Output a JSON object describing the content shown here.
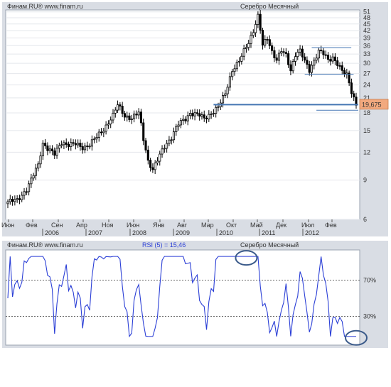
{
  "chart_data": [
    {
      "type": "candlestick",
      "header_left": "Финам.RU®  www.finam.ru",
      "header_right": "Серебро Месячный",
      "y_ticks": [
        6,
        9,
        12,
        15,
        18,
        21,
        24,
        27,
        30,
        33,
        36,
        39,
        42,
        45,
        48,
        51
      ],
      "ylim": [
        6,
        51
      ],
      "y_scale": "log",
      "month_labels": [
        "Июн",
        "Фев",
        "Сен",
        "Апр",
        "Ноя",
        "Июн",
        "Янв",
        "Авг",
        "Мар",
        "Окт",
        "Май",
        "Дек",
        "Июл",
        "Фев"
      ],
      "year_labels": [
        "2006",
        "2007",
        "2008",
        "2009",
        "2010",
        "2011",
        "2012"
      ],
      "last_value_label": "19,675",
      "up_color": "#ffffff",
      "down_color": "#000000",
      "line_color": "#4a7ab5",
      "label_box_color": "#f2a97e",
      "horizontal_lines": [
        {
          "y": 19.6,
          "from_index": 88,
          "to_index": 149,
          "style": "thick"
        },
        {
          "y": 35.3,
          "from_index": 130,
          "to_index": 146,
          "style": "thin"
        },
        {
          "y": 26.8,
          "from_index": 127,
          "to_index": 147,
          "style": "thin"
        },
        {
          "y": 18.5,
          "from_index": 132,
          "to_index": 149,
          "style": "thin"
        }
      ]
    },
    {
      "type": "line",
      "header_left": "Финам.RU®  www.finam.ru",
      "header_center": "RSI (5) = 15,46",
      "header_right": "Серебро Месячный",
      "y_ticks_labels": [
        "70%",
        "30%"
      ],
      "levels": [
        70,
        30
      ],
      "ylim": [
        0,
        100
      ],
      "series_color": "#2b3fd6",
      "circle_color": "#3a5a8a",
      "circles_at_index": [
        102,
        149
      ]
    }
  ]
}
